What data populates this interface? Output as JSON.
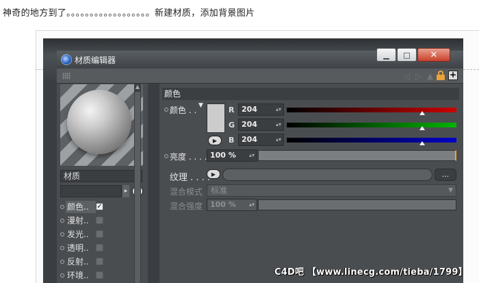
{
  "caption": "神奇的地方到了。。。。。。。。。。。。。。。。。。新建材质，添加背景图片",
  "window": {
    "title": "材质编辑器",
    "buttons": {
      "minimize": "▁",
      "maximize": "□",
      "close": "✕"
    }
  },
  "material": {
    "name": "材质",
    "channels": [
      {
        "label": "颜色..",
        "enabled": true,
        "selected": true
      },
      {
        "label": "漫射..",
        "enabled": false
      },
      {
        "label": "发光..",
        "enabled": false
      },
      {
        "label": "透明..",
        "enabled": false
      },
      {
        "label": "反射..",
        "enabled": false
      },
      {
        "label": "环境..",
        "enabled": false
      }
    ]
  },
  "color_panel": {
    "section_title": "颜色",
    "color_label": "颜色 . .",
    "swatch_color": "#cccccc",
    "r_label": "R",
    "g_label": "G",
    "b_label": "B",
    "r": "204",
    "g": "204",
    "b": "204",
    "slider_level_fraction": 0.8,
    "brightness_label": "亮度 . . . .",
    "brightness_value": "100 %",
    "texture_label": "纹理 . . . .",
    "texture_more": "...",
    "mix_mode_label": "混合模式",
    "mix_mode_value": "标准",
    "mix_strength_label": "混合强度",
    "mix_strength_value": "100 %"
  },
  "colors": {
    "red": "#cc0000",
    "green": "#00b400",
    "blue": "#0000c8",
    "accent": "#e8a33a"
  },
  "watermark": "C4D吧 【www.linecg.com/tieba/1799】"
}
